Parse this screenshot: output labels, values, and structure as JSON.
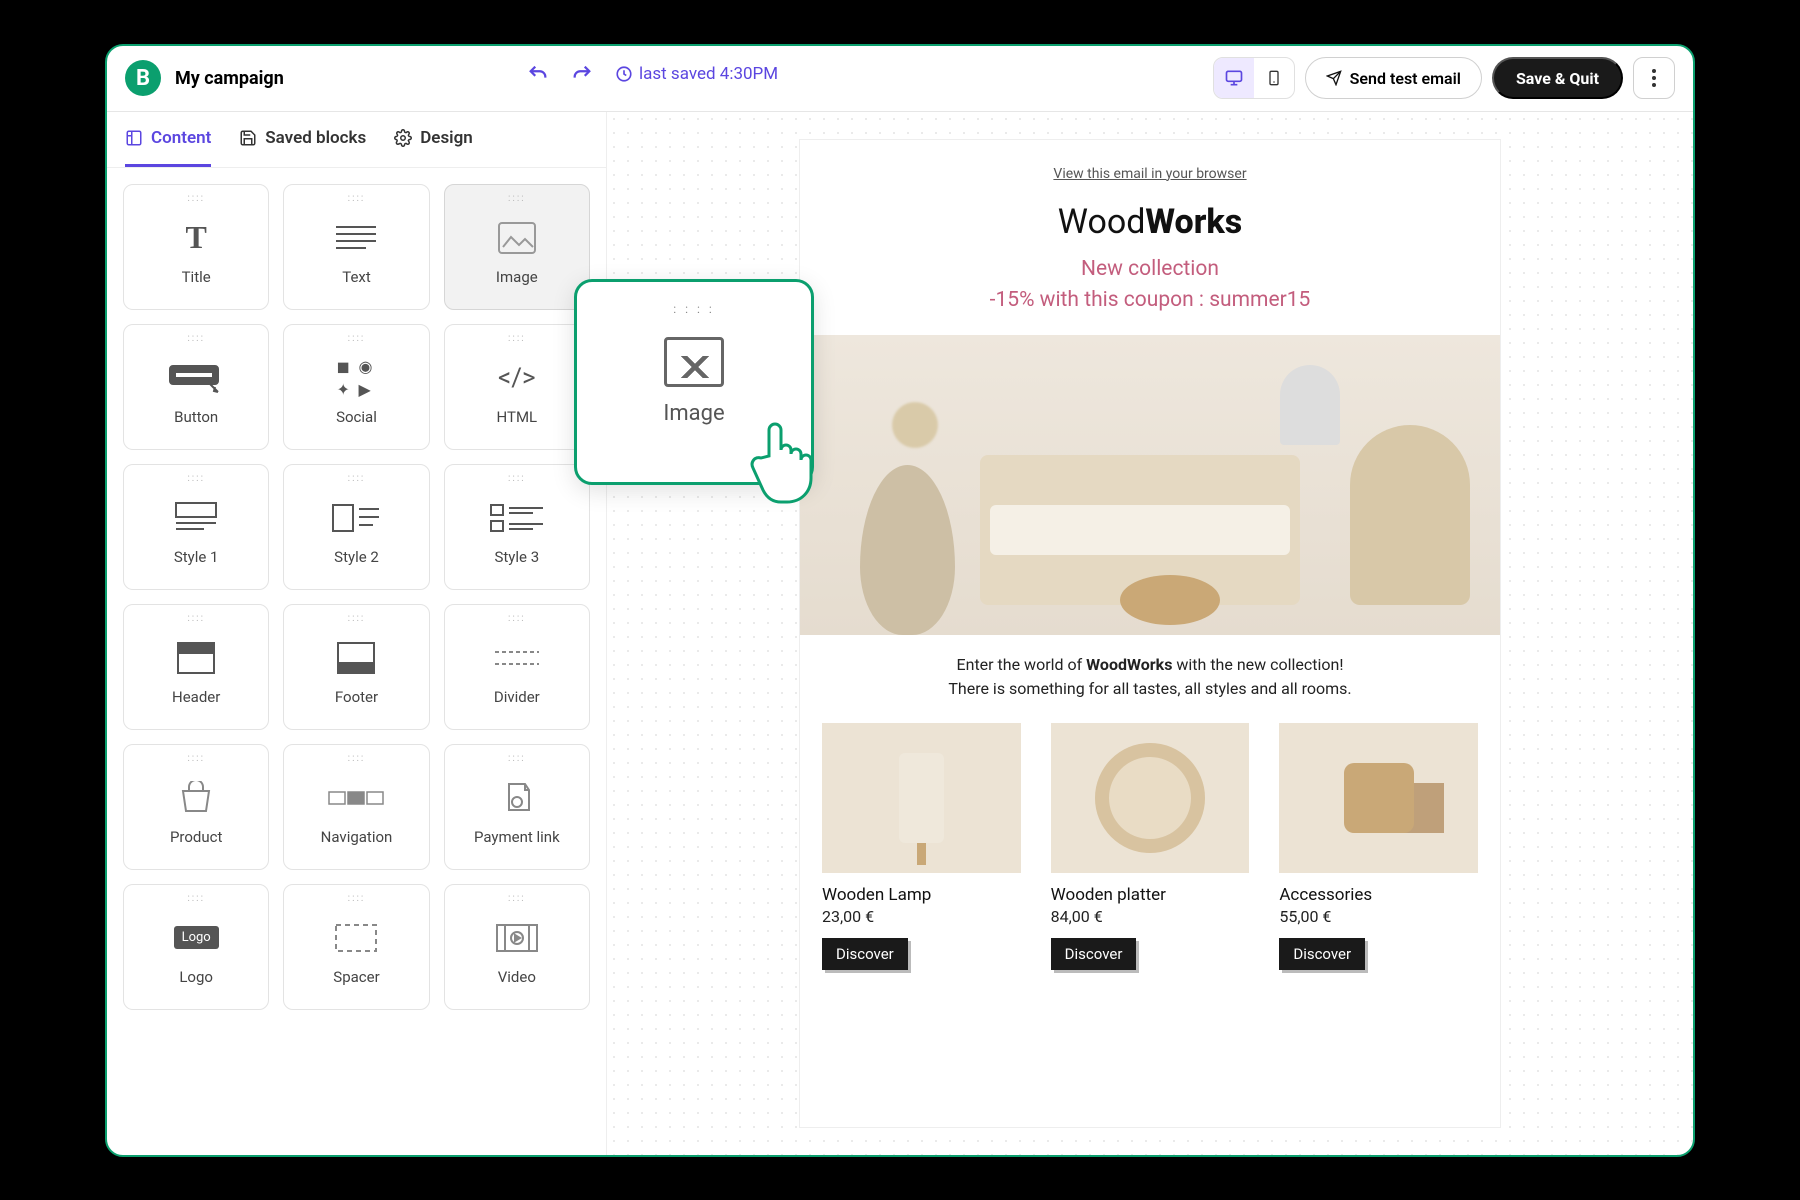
{
  "header": {
    "campaign": "My campaign",
    "saved": "last saved 4:30PM",
    "send_test": "Send test email",
    "save_quit": "Save & Quit",
    "logo_letter": "B"
  },
  "tabs": {
    "content": "Content",
    "saved_blocks": "Saved blocks",
    "design": "Design"
  },
  "blocks": [
    "Title",
    "Text",
    "Image",
    "Button",
    "Social",
    "HTML",
    "Style 1",
    "Style 2",
    "Style 3",
    "Header",
    "Footer",
    "Divider",
    "Product",
    "Navigation",
    "Payment link",
    "Logo",
    "Spacer",
    "Video"
  ],
  "drag": {
    "label": "Image"
  },
  "email": {
    "view_browser": "View this email in your browser",
    "brand_light": "Wood",
    "brand_bold": "Works",
    "promo1": "New collection",
    "promo2": "-15% with this coupon : summer15",
    "intro1": "Enter the world of ",
    "intro_brand": "WoodWorks",
    "intro2": " with the new collection!",
    "intro3": "There is something for all tastes, all styles and all rooms.",
    "products": [
      {
        "name": "Wooden Lamp",
        "price": "23,00 €",
        "cta": "Discover"
      },
      {
        "name": "Wooden platter",
        "price": "84,00 €",
        "cta": "Discover"
      },
      {
        "name": "Accessories",
        "price": "55,00 €",
        "cta": "Discover"
      }
    ]
  }
}
